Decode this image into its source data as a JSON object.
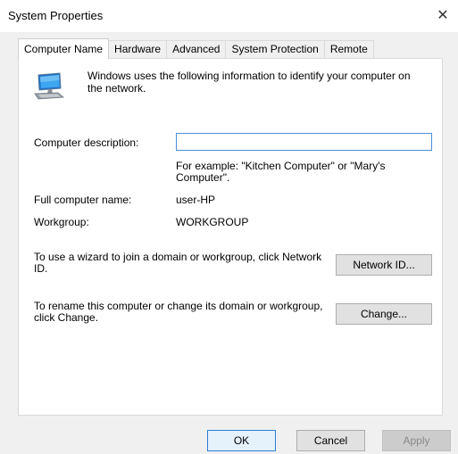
{
  "window": {
    "title": "System Properties",
    "close_symbol": "✕"
  },
  "tabs": [
    {
      "label": "Computer Name",
      "active": true
    },
    {
      "label": "Hardware",
      "active": false
    },
    {
      "label": "Advanced",
      "active": false
    },
    {
      "label": "System Protection",
      "active": false
    },
    {
      "label": "Remote",
      "active": false
    }
  ],
  "computer_name_tab": {
    "icon": "computer-icon",
    "intro": "Windows uses the following information to identify your computer on the network.",
    "description_label": "Computer description:",
    "description_value": "",
    "example_text": "For example: \"Kitchen Computer\" or \"Mary's Computer\".",
    "full_name_label": "Full computer name:",
    "full_name_value": "user-HP",
    "workgroup_label": "Workgroup:",
    "workgroup_value": "WORKGROUP",
    "network_id_text": "To use a wizard to join a domain or workgroup, click Network ID.",
    "network_id_button": "Network ID...",
    "change_text": "To rename this computer or change its domain or workgroup, click Change.",
    "change_button": "Change..."
  },
  "footer": {
    "ok": "OK",
    "cancel": "Cancel",
    "apply": "Apply"
  },
  "colors": {
    "input_border_focus": "#4a90d9",
    "ok_border": "#2b7fd6",
    "client_bg": "#f0f0f0"
  }
}
